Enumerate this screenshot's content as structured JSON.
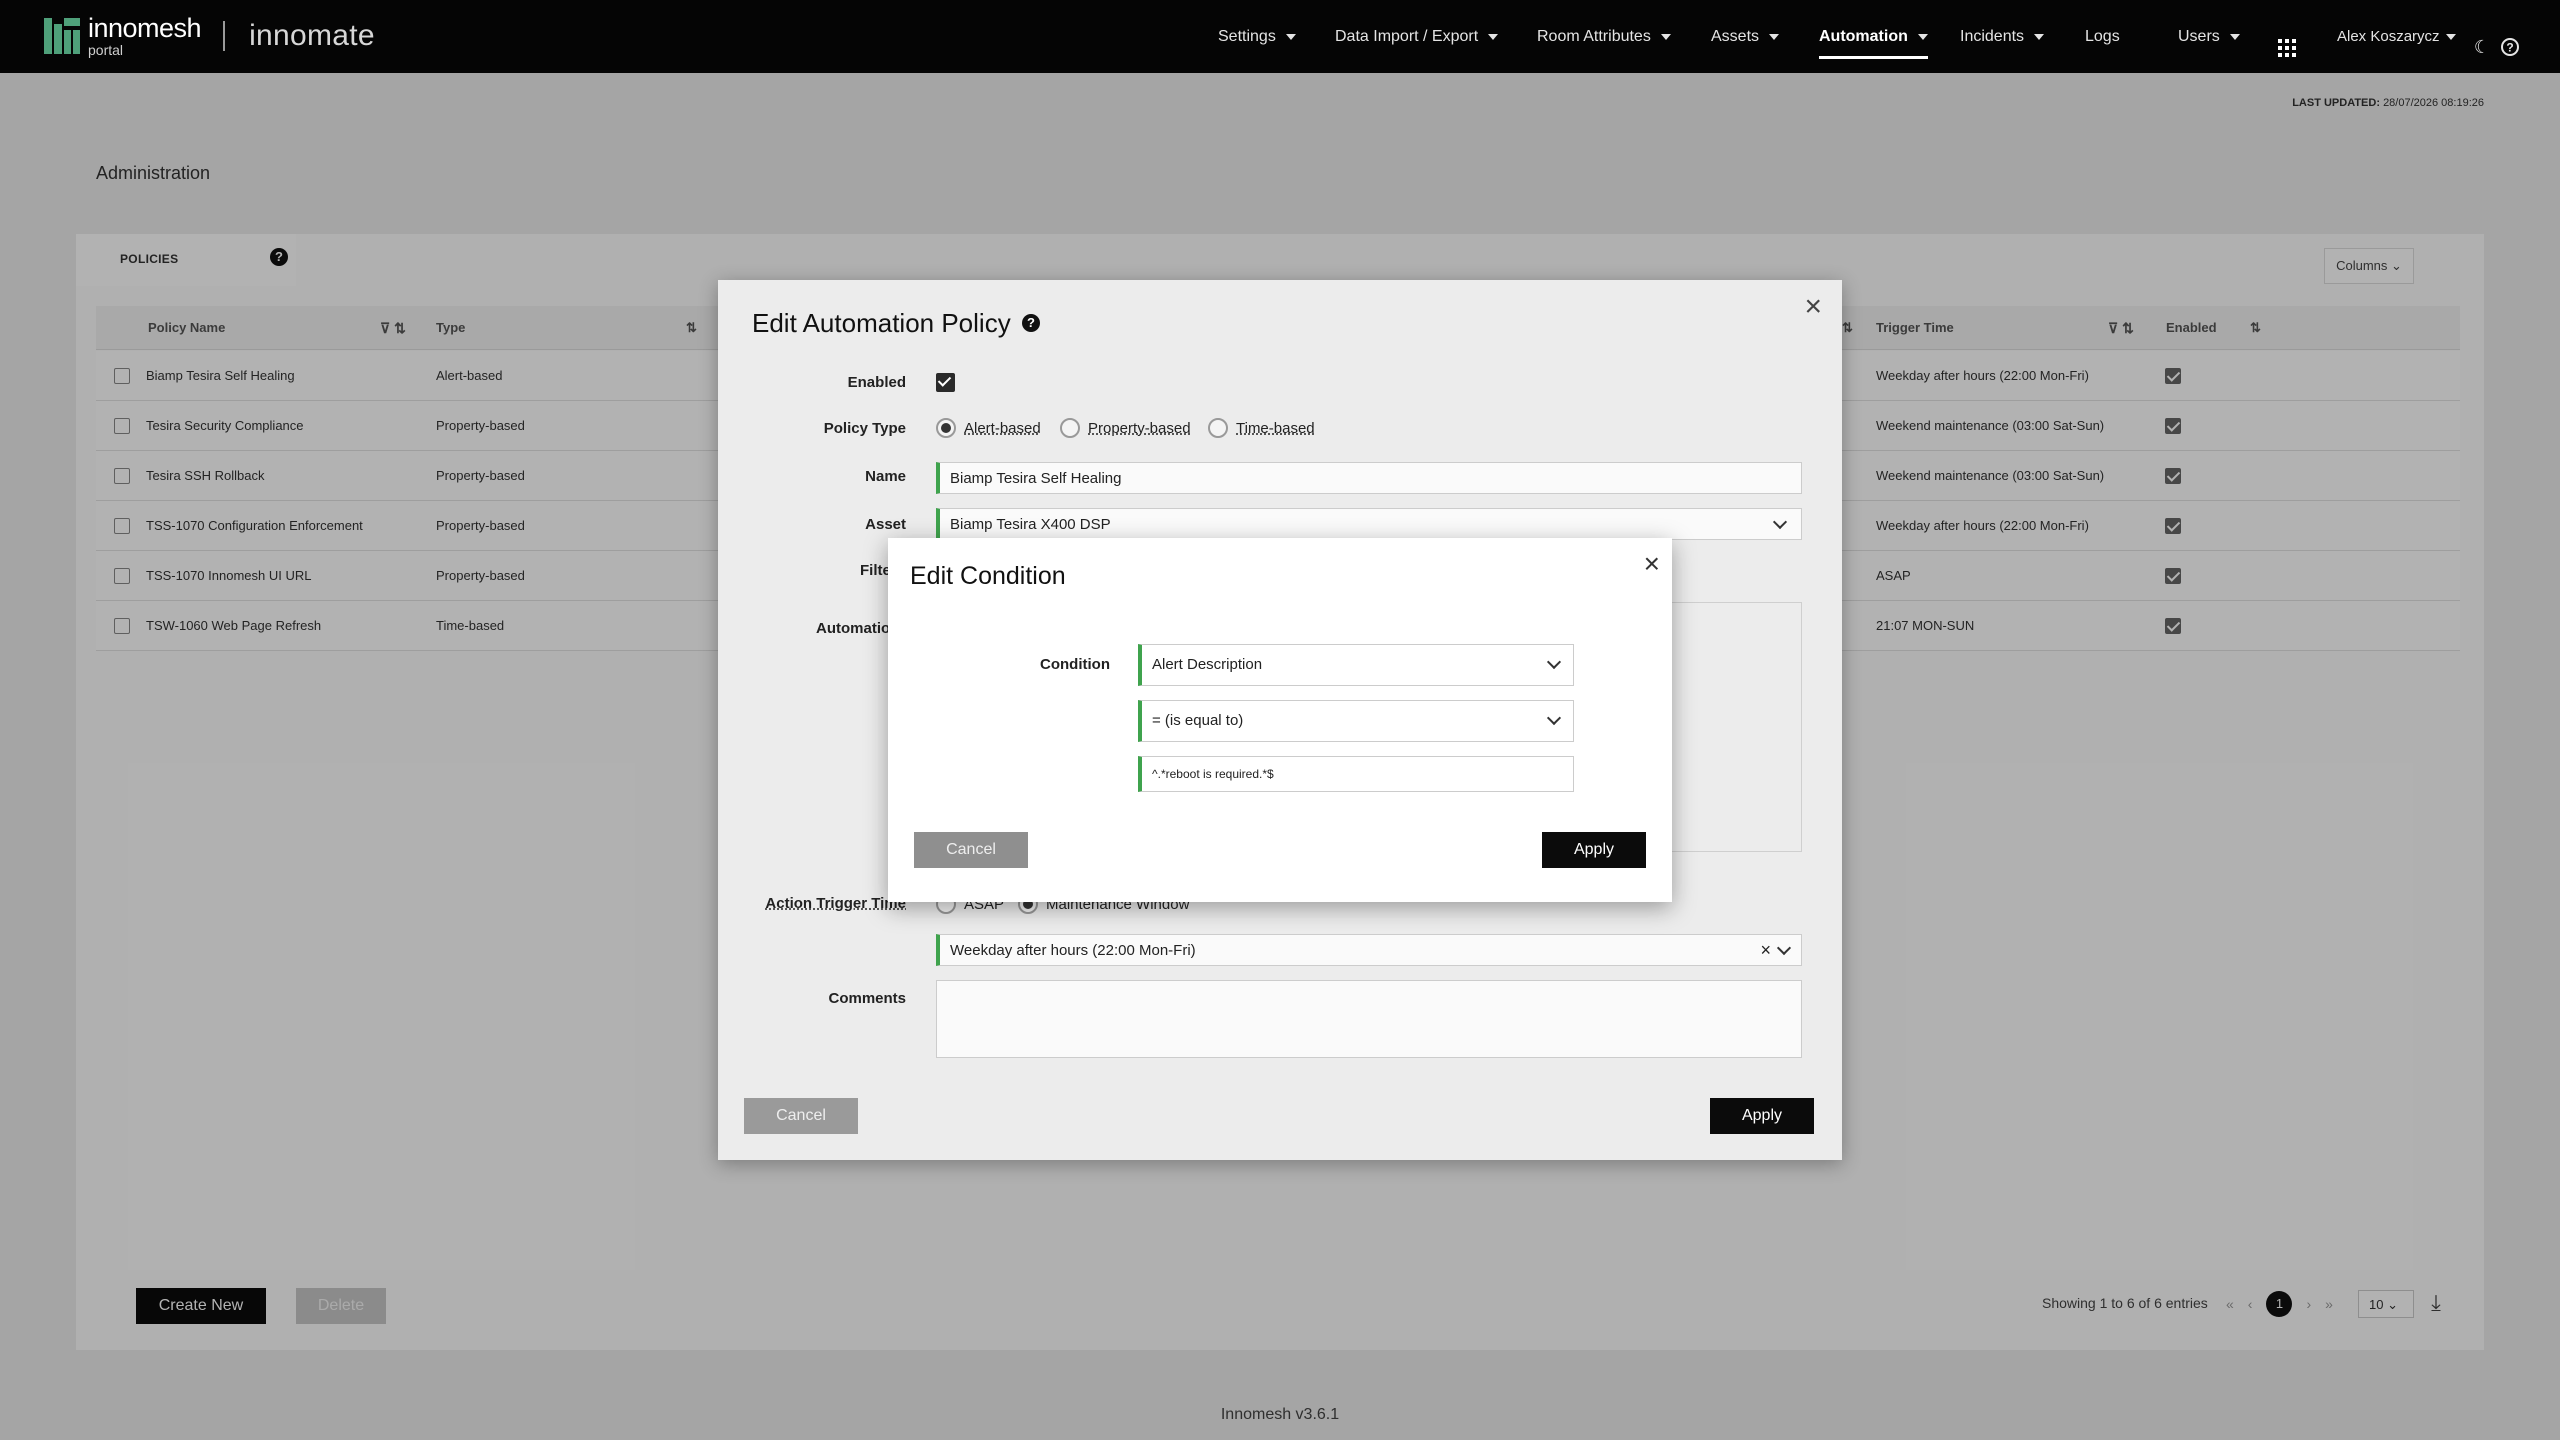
{
  "brand": {
    "name": "innomesh",
    "sub": "portal",
    "product": "innomate"
  },
  "nav": {
    "items": [
      {
        "label": "Settings",
        "caret": true
      },
      {
        "label": "Data Import / Export",
        "caret": true
      },
      {
        "label": "Room Attributes",
        "caret": true
      },
      {
        "label": "Assets",
        "caret": true
      },
      {
        "label": "Automation",
        "caret": true,
        "active": true
      },
      {
        "label": "Incidents",
        "caret": true
      },
      {
        "label": "Logs",
        "caret": false
      },
      {
        "label": "Users",
        "caret": true
      }
    ],
    "user": "Alex Koszarycz"
  },
  "last_updated": {
    "label": "LAST UPDATED:",
    "value": "28/07/2026 08:19:26"
  },
  "page_title": "Administration",
  "tabs": {
    "policies": "POLICIES",
    "help": "?"
  },
  "columns_label": "Columns",
  "table": {
    "headers": [
      "Policy Name",
      "Type",
      "Trigger Time",
      "Enabled"
    ],
    "rows": [
      {
        "name": "Biamp Tesira Self Healing",
        "type": "Alert-based",
        "trigger": "Weekday after hours (22:00 Mon-Fri)",
        "enabled": true
      },
      {
        "name": "Tesira Security Compliance",
        "type": "Property-based",
        "trigger": "Weekend maintenance (03:00 Sat-Sun)",
        "enabled": true
      },
      {
        "name": "Tesira SSH Rollback",
        "type": "Property-based",
        "trigger": "Weekend maintenance (03:00 Sat-Sun)",
        "enabled": true
      },
      {
        "name": "TSS-1070 Configuration Enforcement",
        "type": "Property-based",
        "trigger": "Weekday after hours (22:00 Mon-Fri)",
        "enabled": true
      },
      {
        "name": "TSS-1070 Innomesh UI URL",
        "type": "Property-based",
        "trigger": "ASAP",
        "enabled": true
      },
      {
        "name": "TSW-1060 Web Page Refresh",
        "type": "Time-based",
        "trigger": "21:07 MON-SUN",
        "enabled": true
      }
    ]
  },
  "actions": {
    "create": "Create New",
    "delete": "Delete"
  },
  "pagination": {
    "showing": "Showing 1 to 6 of 6 entries",
    "current": "1",
    "per_page": "10"
  },
  "footer": "Innomesh v3.6.1",
  "policy_modal": {
    "title": "Edit Automation Policy",
    "help": "?",
    "enabled_label": "Enabled",
    "policy_type_label": "Policy Type",
    "policy_types": [
      "Alert-based",
      "Property-based",
      "Time-based"
    ],
    "name_label": "Name",
    "name_value": "Biamp Tesira Self Healing",
    "asset_label": "Asset",
    "asset_value": "Biamp Tesira X400 DSP",
    "filter_label": "Filte",
    "automation_label": "Automatio",
    "trigger_label": "Action Trigger Time",
    "trigger_options": [
      "ASAP",
      "Maintenance Window"
    ],
    "window_value": "Weekday after hours (22:00 Mon-Fri)",
    "comments_label": "Comments",
    "cancel": "Cancel",
    "apply": "Apply"
  },
  "condition_modal": {
    "title": "Edit Condition",
    "condition_label": "Condition",
    "field": "Alert Description",
    "operator": "= (is equal to)",
    "value": "^.*reboot is required.*$",
    "cancel": "Cancel",
    "apply": "Apply"
  }
}
